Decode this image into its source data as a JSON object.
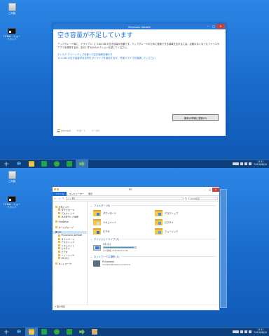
{
  "top": {
    "desktop_icons": [
      {
        "label": "ごみ箱",
        "icon": "recycle-bin-icon"
      },
      {
        "label": "TVTest - ショートカット",
        "icon": "shortcut-icon"
      }
    ],
    "dialog": {
      "title": "Windows Update",
      "heading": "空き容量が不足しています",
      "description": "アップグレード時に、ドライブ C: に 5.00 GB の空き容量が必要です。アップグレードのために使用できる領域を空けるには、必要のなくなったファイルやアプリを削除するか、次のいずれかのオプションを試してください。",
      "link1": "ディスク クリーンアップを使って空き領域を増やす",
      "link2": "11.0 GB の空き容量がある外付けドライブを追加するか、外部ドライブを接続してください",
      "action_button": "最新の情報に更新(R)",
      "footer_brand": "Microsoft",
      "footer_support": "サポート",
      "footer_legal": "リーガル"
    },
    "clock": {
      "time": "11:41",
      "date": "2019/08/20"
    }
  },
  "bottom": {
    "desktop_icons": [
      {
        "label": "ごみ箱",
        "icon": "recycle-bin-icon"
      },
      {
        "label": "TVTest - ショートカット",
        "icon": "shortcut-icon"
      }
    ],
    "explorer": {
      "title": "PC",
      "ribbon": {
        "file": "ファイル",
        "computer": "コンピューター",
        "view": "表示"
      },
      "address": "PC",
      "search_placeholder": "PCの検索",
      "nav": [
        {
          "label": "お気に入り",
          "kind": "group"
        },
        {
          "label": "ダウンロード",
          "kind": "sub"
        },
        {
          "label": "デスクトップ",
          "kind": "sub"
        },
        {
          "label": "最近表示した場所",
          "kind": "sub"
        },
        {
          "label": "OneDrive",
          "kind": "group"
        },
        {
          "label": "ホームグループ",
          "kind": "group"
        },
        {
          "label": "PC",
          "kind": "group-selected"
        },
        {
          "label": "PcConnect (AirVide",
          "kind": "sub"
        },
        {
          "label": "ダウンロード",
          "kind": "sub"
        },
        {
          "label": "デスクトップ",
          "kind": "sub"
        },
        {
          "label": "ドキュメント",
          "kind": "sub"
        },
        {
          "label": "ピクチャ",
          "kind": "sub"
        },
        {
          "label": "ビデオ",
          "kind": "sub"
        },
        {
          "label": "ミュージック",
          "kind": "sub"
        },
        {
          "label": "OS (C:)",
          "kind": "sub"
        },
        {
          "label": "ネットワーク",
          "kind": "group"
        }
      ],
      "folders_header": "フォルダー (6)",
      "folders": [
        {
          "name": "ダウンロード",
          "overlay": "#3f7fd6"
        },
        {
          "name": "デスクトップ",
          "overlay": "#4c8be0"
        },
        {
          "name": "ドキュメント",
          "overlay": "#d8d8d8"
        },
        {
          "name": "ピクチャ",
          "overlay": "#5aa0d8"
        },
        {
          "name": "ビデオ",
          "overlay": "#4a6fb0"
        },
        {
          "name": "ミュージック",
          "overlay": "#6aa2d9"
        }
      ],
      "devices_header": "デバイスとドライブ (1)",
      "drive": {
        "name": "OS (C:)",
        "free_text": "空き領域 1.68 GB/29.3 GB",
        "used_fraction": 0.94
      },
      "network_header": "ネットワークの場所 (1)",
      "network": {
        "name": "PcConnect",
        "sub": "(AirVideoMediaServer\\XXX-X..."
      },
      "status": "9 個の項目"
    },
    "clock": {
      "time": "11:41",
      "date": "2019/08/20"
    }
  }
}
